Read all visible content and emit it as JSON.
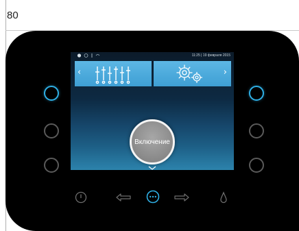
{
  "page": {
    "label": "80"
  },
  "screen": {
    "status_time": "11:25 | 19 февраля 2015",
    "power_label": "Включение",
    "tile_left_arrow": "‹",
    "tile_right_arrow": "›"
  },
  "icons": {
    "status": [
      "lock-icon",
      "clock-icon",
      "thermometer-icon",
      "wifi-icon"
    ],
    "tiles": [
      "equalizer-icon",
      "gears-icon"
    ],
    "bottom": [
      "power-icon",
      "arrow-left-icon",
      "menu-dots-icon",
      "arrow-right-icon",
      "drop-icon"
    ]
  },
  "colors": {
    "accent": "#2fb0e6",
    "tile": "#4aa8da",
    "inactive": "#5a5a5a",
    "device": "#000000"
  }
}
